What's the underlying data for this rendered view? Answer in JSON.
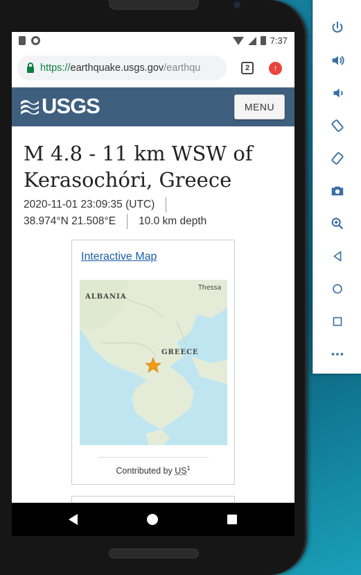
{
  "status_bar": {
    "time": "7:37"
  },
  "browser": {
    "url_scheme": "https://",
    "url_host": "earthquake.usgs.gov",
    "url_path": "/earthqu",
    "tab_count": "2"
  },
  "header": {
    "logo_text": "USGS",
    "menu_label": "MENU"
  },
  "event": {
    "title": "M 4.8 - 11 km WSW of Kerasochóri, Greece",
    "datetime": "2020-11-01 23:09:35 (UTC)",
    "coordinates": "38.974°N 21.508°E",
    "depth": "10.0 km depth"
  },
  "map_card": {
    "link_label": "Interactive Map",
    "map_labels": {
      "albania": "ALBANIA",
      "greece": "GREECE",
      "thessaloniki": "Thessa"
    },
    "contributed_prefix": "Contributed by ",
    "contributed_link": "US",
    "contributed_sup": "1"
  },
  "colors": {
    "usgs_blue": "#3f5f7f",
    "link_blue": "#1a5ea8",
    "secure_green": "#0b8043",
    "epicenter_star": "#f39c12"
  },
  "icons": {
    "toolbar": [
      "power-icon",
      "volume-up-icon",
      "volume-down-icon",
      "rotate-left-icon",
      "rotate-right-icon",
      "camera-icon",
      "zoom-icon",
      "back-icon",
      "home-icon",
      "overview-icon",
      "more-icon"
    ]
  }
}
